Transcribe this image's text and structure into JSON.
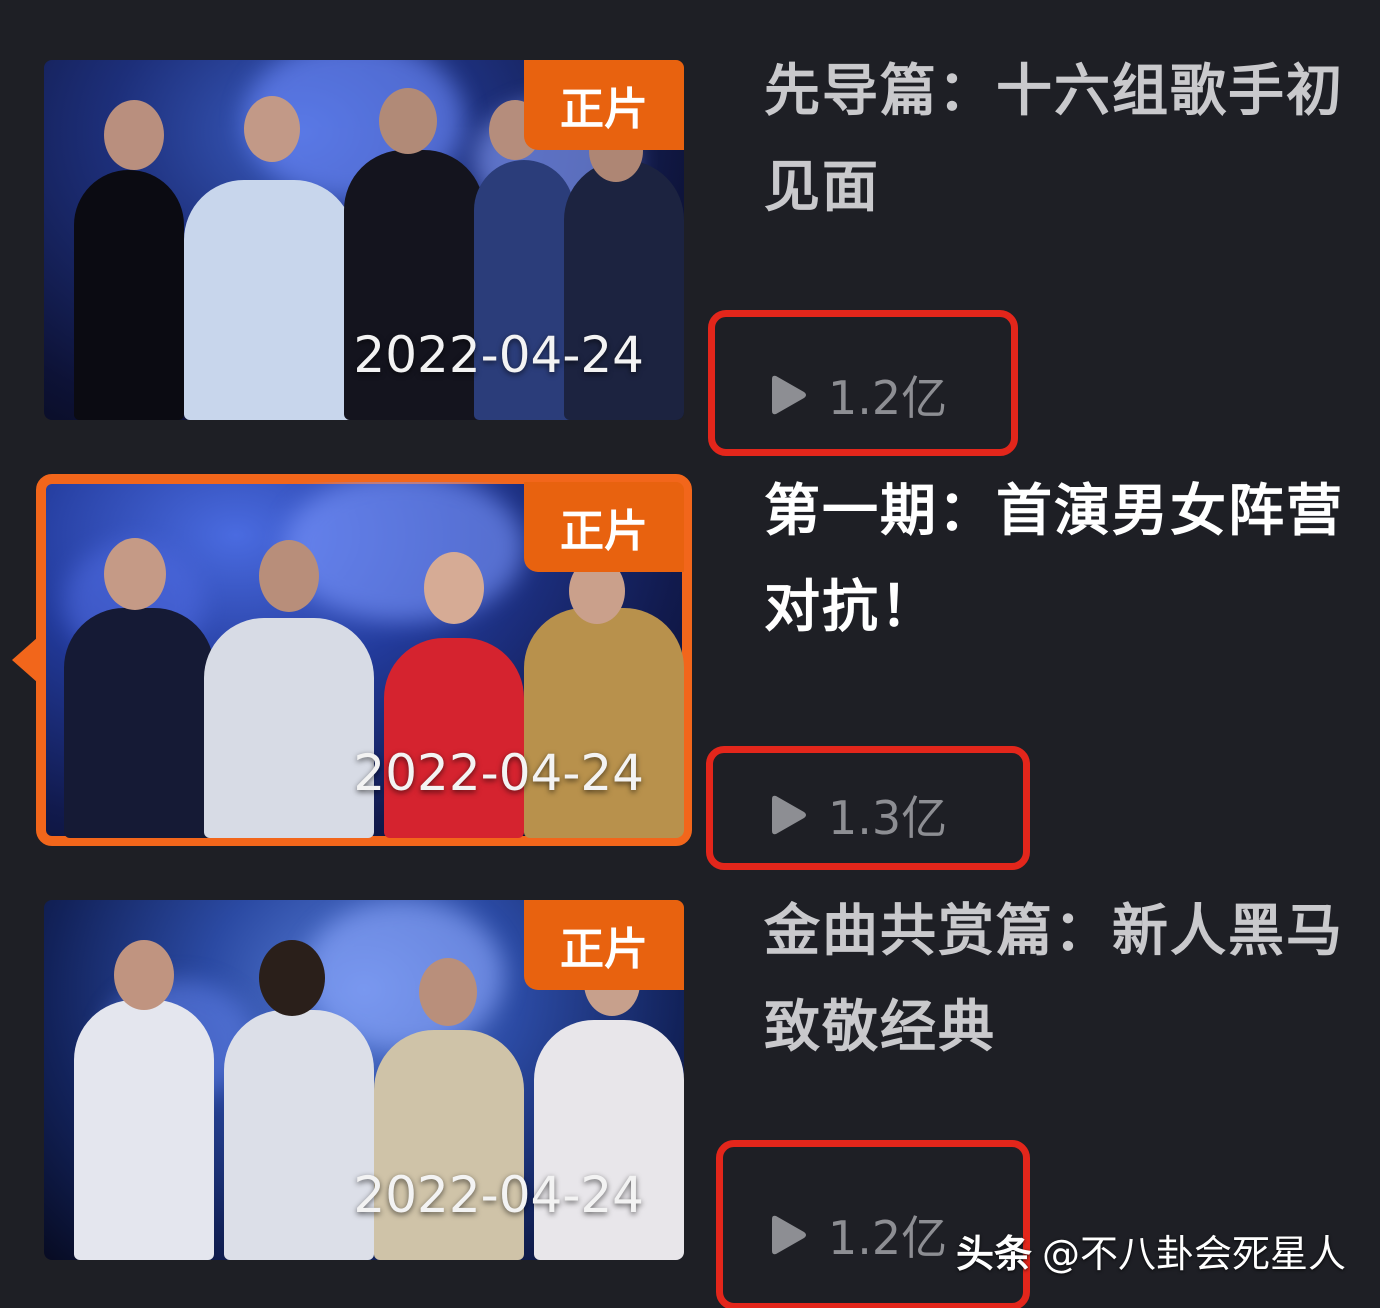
{
  "episodes": [
    {
      "title": "先导篇：十六组歌手初见面",
      "title_line1": "先导篇：十六组歌手初",
      "title_line2": "见面",
      "badge": "正片",
      "date": "2022-04-24",
      "plays": "1.2亿",
      "selected": false
    },
    {
      "title": "第一期：首演男女阵营对抗！",
      "title_line1": "第一期：首演男女阵营",
      "title_line2": "对抗！",
      "badge": "正片",
      "date": "2022-04-24",
      "plays": "1.3亿",
      "selected": true
    },
    {
      "title": "金曲共赏篇：新人黑马致敬经典",
      "title_line1": "金曲共赏篇：新人黑马",
      "title_line2": "致敬经典",
      "badge": "正片",
      "date": "2022-04-24",
      "plays": "1.2亿",
      "selected": false
    }
  ],
  "watermark": {
    "brand": "头条",
    "handle": "@不八卦会死星人"
  },
  "colors": {
    "background": "#1e1f25",
    "accent": "#f2661b",
    "badge": "#e8620f",
    "highlight": "#e3261b",
    "title_inactive": "#c9c9cc",
    "title_active": "#ffffff",
    "plays": "#8d8e93"
  },
  "icons": [
    "play-icon"
  ]
}
